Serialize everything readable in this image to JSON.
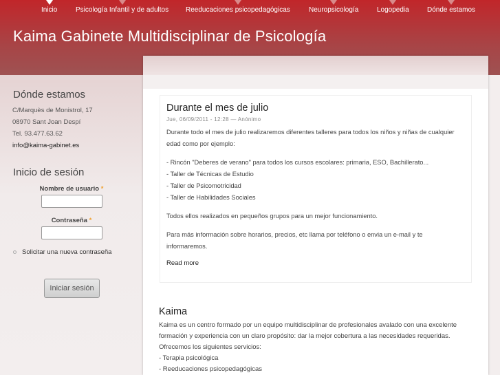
{
  "nav": [
    "Inicio",
    "Psicología Infantil y de adultos",
    "Reeducaciones psicopedagógicas",
    "Neuropsicología",
    "Logopedia",
    "Dónde estamos"
  ],
  "site_title": "Kaima Gabinete Multidisciplinar de Psicología",
  "sidebar": {
    "location": {
      "title": "Dónde estamos",
      "lines": [
        "C/Marquès de Monistrol, 17",
        "08970 Sant Joan Despí",
        "Tel. 93.477.63.62"
      ],
      "email": "info@kaima-gabinet.es"
    },
    "login": {
      "title": "Inicio de sesión",
      "username_label": "Nombre de usuario",
      "password_label": "Contraseña",
      "required": "*",
      "new_password": "Solicitar una nueva contraseña",
      "submit": "Iniciar sesión"
    }
  },
  "article": {
    "title": "Durante el mes de julio",
    "meta": "Jue, 06/09/2011 - 12:28 — Anónimo",
    "p1": "Durante todo el mes de julio realizaremos diferentes talleres para todos los niños y niñas de cualquier edad como por ejemplo:",
    "list": [
      "- Rincón \"Deberes de verano\" para todos los cursos escolares: primaria, ESO, Bachillerato...",
      "- Taller de Técnicas de Estudio",
      "- Taller de Psicomotricidad",
      "- Taller de Habilidades Sociales"
    ],
    "p2": "Todos ellos realizados en pequeños grupos para un mejor funcionamiento.",
    "p3": "Para más información sobre horarios, precios, etc llama por teléfono o envia un e-mail y te informaremos.",
    "read_more": "Read more"
  },
  "kaima": {
    "title": "Kaima",
    "p1": "Kaima es un centro formado por un equipo multidisciplinar de profesionales avalado con una excelente formación y experiencia con un claro propósito: dar la mejor cobertura a las necesidades requeridas.",
    "p2": "Ofrecemos los siguientes servicios:",
    "list": [
      "- Terapia psicológica",
      "- Reeducaciones psicopedagógicas"
    ]
  }
}
